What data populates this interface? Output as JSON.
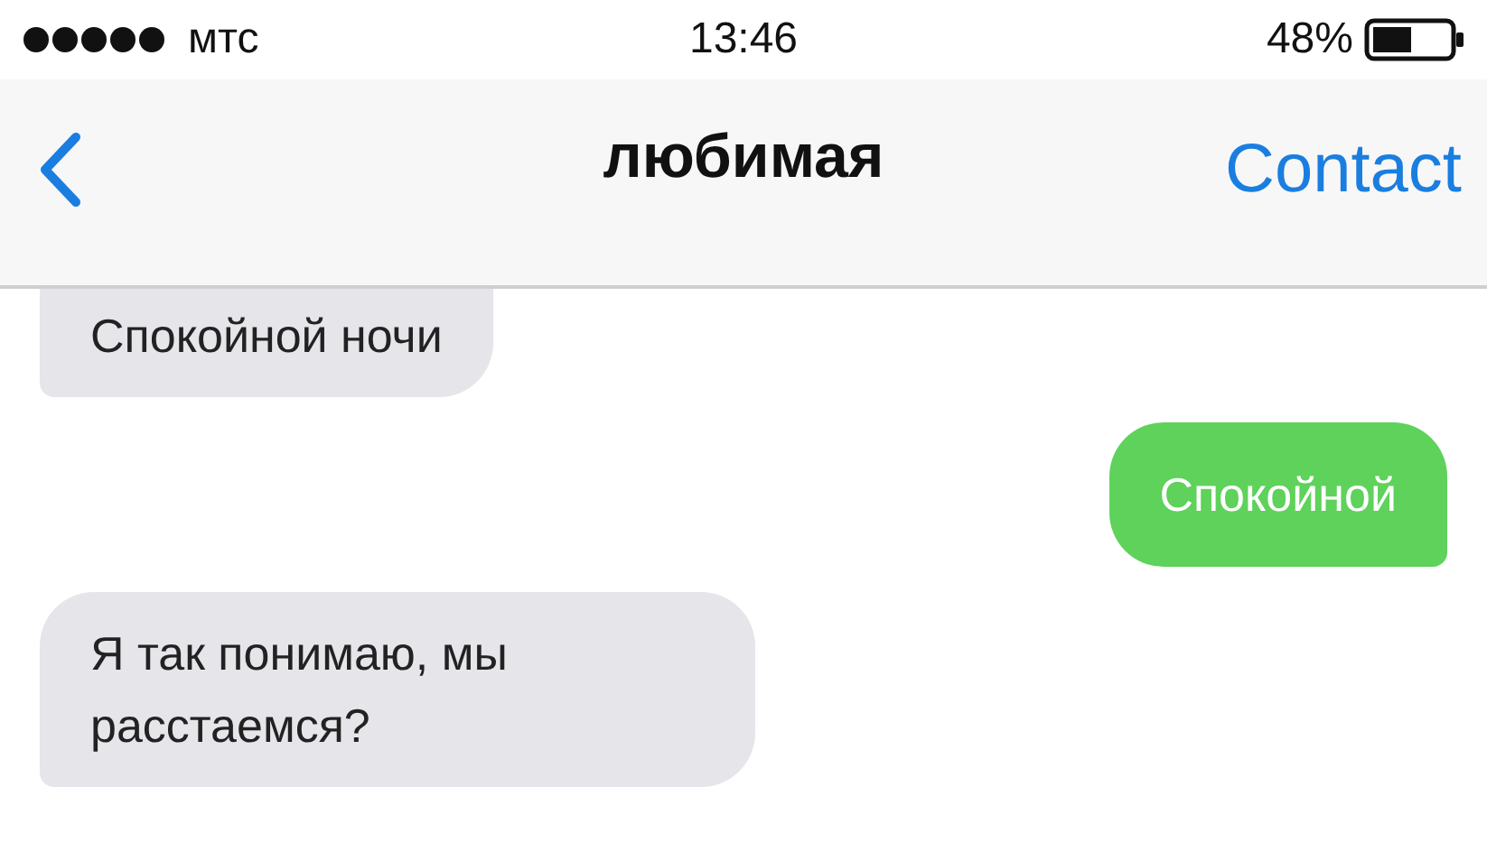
{
  "status_bar": {
    "carrier": "мтс",
    "time": "13:46",
    "battery": "48%"
  },
  "nav": {
    "title": "любимая",
    "action": "Contact"
  },
  "messages": [
    {
      "kind": "incoming",
      "text": "Спокойной ночи"
    },
    {
      "kind": "outgoing",
      "text": "Спокойной"
    },
    {
      "kind": "incoming",
      "text": "Я так понимаю, мы расстаемся?"
    }
  ]
}
